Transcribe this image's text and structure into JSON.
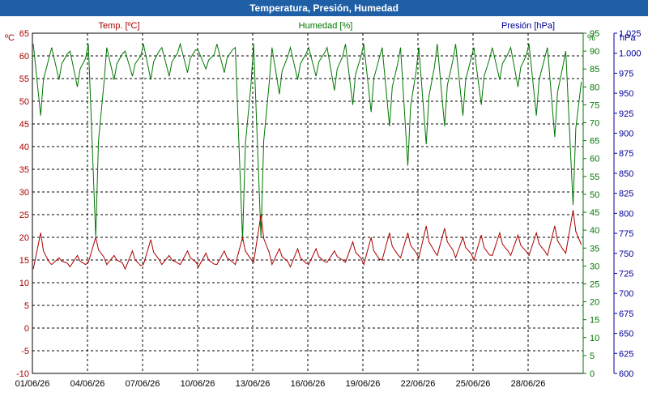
{
  "window": {
    "title": "Temperatura, Presión, Humedad"
  },
  "legend": {
    "temp": "Temp. [ºC]",
    "humidity": "Humedad [%]",
    "pressure": "Presión [hPa]"
  },
  "axis_units": {
    "left": "ºC",
    "right1": "%",
    "right2": "hPa"
  },
  "colors": {
    "temp": "#aa0000",
    "humidity": "#007700",
    "pressure": "#000099",
    "title_bar": "#1f5fa6"
  },
  "chart_data": {
    "type": "line",
    "title": "Temperatura, Presión, Humedad",
    "x_range": [
      "01/06/26",
      "01/07/26"
    ],
    "x_tick_labels": [
      "01/06/26",
      "04/06/26",
      "07/06/26",
      "10/06/26",
      "13/06/26",
      "16/06/26",
      "19/06/26",
      "22/06/26",
      "25/06/26",
      "28/06/26"
    ],
    "y_left": {
      "label": "ºC",
      "ylim": [
        -10,
        65
      ],
      "ticks": [
        "-10",
        "-5",
        "0",
        "5",
        "10",
        "15",
        "20",
        "25",
        "30",
        "35",
        "40",
        "45",
        "50",
        "55",
        "60",
        "65"
      ]
    },
    "y_right_humidity": {
      "label": "%",
      "ylim": [
        0,
        95
      ],
      "ticks": [
        "0",
        "5",
        "10",
        "15",
        "20",
        "25",
        "30",
        "35",
        "40",
        "45",
        "50",
        "55",
        "60",
        "65",
        "70",
        "75",
        "80",
        "85",
        "90",
        "95"
      ]
    },
    "y_right_pressure": {
      "label": "hPa",
      "ylim": [
        600,
        1025
      ],
      "ticks": [
        "600",
        "625",
        "650",
        "675",
        "700",
        "725",
        "750",
        "775",
        "800",
        "825",
        "850",
        "875",
        "900",
        "925",
        "950",
        "975",
        "1.000",
        "1.025"
      ]
    },
    "grid": true,
    "series": [
      {
        "name": "Temp. [ºC]",
        "axis": "left",
        "daily_min": [
          13,
          14,
          13.5,
          14.5,
          14,
          13,
          14,
          14,
          14,
          13.5,
          14,
          14,
          14.5,
          14,
          13.5,
          14,
          14.5,
          14.5,
          14,
          15,
          15.5,
          15.5,
          16,
          15.5,
          15,
          16,
          16,
          16,
          16,
          16.5
        ],
        "daily_max": [
          21,
          15.5,
          16,
          20,
          16,
          17,
          19.5,
          16,
          17,
          16.5,
          17,
          20,
          25,
          17.5,
          17.5,
          17.5,
          17,
          19,
          20,
          21,
          21,
          22.5,
          22,
          20,
          20.5,
          21,
          20.5,
          21,
          22.5,
          26
        ]
      },
      {
        "name": "Humedad [%]",
        "axis": "right1",
        "daily_max": [
          92,
          91,
          90,
          92,
          91,
          90,
          92,
          91,
          92,
          90,
          92,
          91,
          92,
          91,
          91,
          91,
          91,
          92,
          92,
          91,
          91,
          91,
          92,
          92,
          91,
          91,
          91,
          92,
          91,
          90
        ],
        "daily_min": [
          72,
          82,
          80,
          38,
          82,
          83,
          82,
          83,
          84,
          85,
          84,
          37,
          38,
          78,
          82,
          83,
          79,
          75,
          73,
          69,
          58,
          64,
          69,
          72,
          75,
          82,
          80,
          72,
          66,
          47
        ]
      }
    ]
  }
}
